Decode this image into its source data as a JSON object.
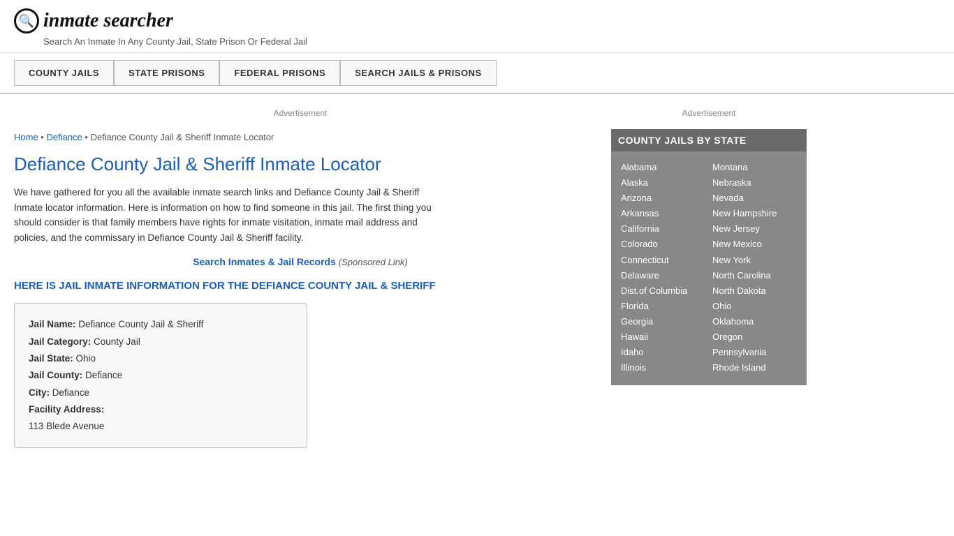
{
  "header": {
    "logo_icon": "🔍",
    "logo_text": "inmate searcher",
    "tagline": "Search An Inmate In Any County Jail, State Prison Or Federal Jail"
  },
  "nav": {
    "items": [
      {
        "id": "county-jails",
        "label": "COUNTY JAILS"
      },
      {
        "id": "state-prisons",
        "label": "STATE PRISONS"
      },
      {
        "id": "federal-prisons",
        "label": "FEDERAL PRISONS"
      },
      {
        "id": "search-jails",
        "label": "SEARCH JAILS & PRISONS"
      }
    ]
  },
  "breadcrumb": {
    "home": "Home",
    "separator1": " • ",
    "defiance": "Defiance",
    "separator2": " • ",
    "current": "Defiance County Jail & Sheriff Inmate Locator"
  },
  "content": {
    "page_title": "Defiance County Jail & Sheriff Inmate Locator",
    "body_text": "We have gathered for you all the available inmate search links and Defiance County Jail & Sheriff Inmate locator information. Here is information on how to find someone in this jail. The first thing you should consider is that family members have rights for inmate visitation, inmate mail address and policies, and the commissary in Defiance County Jail & Sheriff facility.",
    "search_link_text": "Search Inmates & Jail Records",
    "sponsored_text": "(Sponsored Link)",
    "section_heading": "HERE IS JAIL INMATE INFORMATION FOR THE DEFIANCE COUNTY JAIL & SHERIFF",
    "ad_label": "Advertisement"
  },
  "info_card": {
    "fields": [
      {
        "label": "Jail Name:",
        "value": "Defiance County Jail & Sheriff"
      },
      {
        "label": "Jail Category:",
        "value": "County Jail"
      },
      {
        "label": "Jail State:",
        "value": "Ohio"
      },
      {
        "label": "Jail County:",
        "value": "Defiance"
      },
      {
        "label": "City:",
        "value": "Defiance"
      },
      {
        "label": "Facility Address:",
        "value": ""
      },
      {
        "label": "",
        "value": "113 Blede Avenue"
      }
    ]
  },
  "sidebar": {
    "title": "COUNTY JAILS BY STATE",
    "ad_label": "Advertisement",
    "left_column": [
      "Alabama",
      "Alaska",
      "Arizona",
      "Arkansas",
      "California",
      "Colorado",
      "Connecticut",
      "Delaware",
      "Dist.of Columbia",
      "Florida",
      "Georgia",
      "Hawaii",
      "Idaho",
      "Illinois"
    ],
    "right_column": [
      "Montana",
      "Nebraska",
      "Nevada",
      "New Hampshire",
      "New Jersey",
      "New Mexico",
      "New York",
      "North Carolina",
      "North Dakota",
      "Ohio",
      "Oklahoma",
      "Oregon",
      "Pennsylvania",
      "Rhode Island"
    ]
  }
}
